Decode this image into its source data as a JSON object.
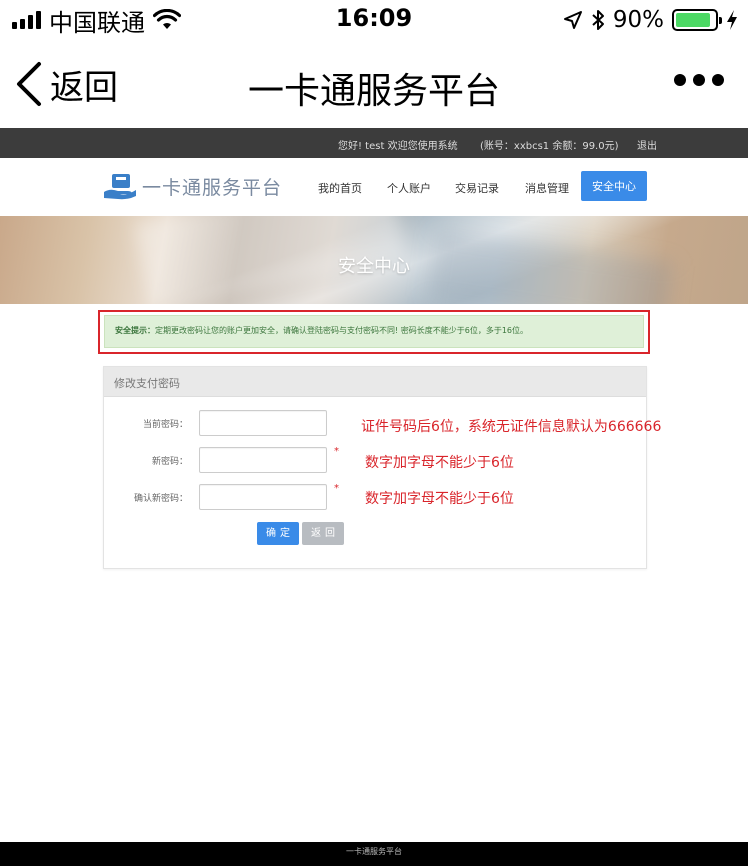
{
  "status_bar": {
    "carrier": "中国联通",
    "time": "16:09",
    "battery": "90%",
    "battery_level": 0.9
  },
  "nav": {
    "back_label": "返回",
    "title": "一卡通服务平台"
  },
  "topbar": {
    "welcome": "您好! test 欢迎您使用系统",
    "account": "(账号：xxbcs1 余额：99.0元)",
    "logout": "退出"
  },
  "header": {
    "logo_text": "一卡通服务平台",
    "menu": [
      "我的首页",
      "个人账户",
      "交易记录",
      "消息管理",
      "安全中心"
    ],
    "active_menu": "安全中心"
  },
  "banner": {
    "title": "安全中心"
  },
  "notice": {
    "label": "安全提示：",
    "text": "定期更改密码让您的账户更加安全，请确认登陆密码与支付密码不同! 密码长度不能少于6位，多于16位。"
  },
  "form": {
    "title": "修改支付密码",
    "fields": [
      {
        "label": "当前密码：",
        "hint": "证件号码后6位，系统无证件信息默认为666666"
      },
      {
        "label": "新密码：",
        "hint": "数字加字母不能少于6位",
        "required": "*"
      },
      {
        "label": "确认新密码：",
        "hint": "数字加字母不能少于6位",
        "required": "*"
      }
    ],
    "submit_label": "确定",
    "back_label": "返回"
  },
  "footer": {
    "text": "一卡通服务平台"
  }
}
